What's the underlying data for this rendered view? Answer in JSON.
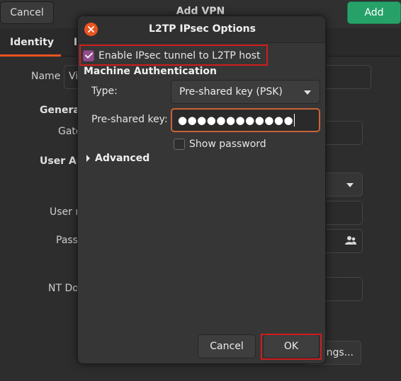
{
  "background_window": {
    "title": "Add VPN",
    "cancel_label": "Cancel",
    "add_label": "Add",
    "tabs": [
      {
        "label": "Identity"
      },
      {
        "label": "I"
      }
    ],
    "name_label": "Name",
    "name_value": "Vi",
    "general_section": "Genera",
    "gateway_label": "Gate",
    "user_auth_section": "User Au",
    "username_label": "User n",
    "password_label": "Pass",
    "nt_domain_label": "NT Do",
    "settings_button_fragment": "ings..."
  },
  "dialog": {
    "title": "L2TP IPsec Options",
    "enable_ipsec_label": "Enable IPsec tunnel to L2TP host",
    "enable_ipsec_checked": true,
    "machine_auth_section": "Machine Authentication",
    "type_label": "Type:",
    "type_value": "Pre-shared key (PSK)",
    "psk_label": "Pre-shared key:",
    "psk_masked": "●●●●●●●●●●●●",
    "show_password_label": "Show password",
    "show_password_checked": false,
    "advanced_label": "Advanced",
    "cancel_label": "Cancel",
    "ok_label": "OK"
  },
  "colors": {
    "accent": "#e95420",
    "check_bg": "#924d8b",
    "add_button": "#26a269",
    "highlight_outline": "#d01c1c"
  },
  "icons": {
    "close": "close-icon",
    "check": "checkmark-icon",
    "dropdown": "chevron-down-icon",
    "expander": "triangle-right-icon",
    "people": "users-icon"
  }
}
